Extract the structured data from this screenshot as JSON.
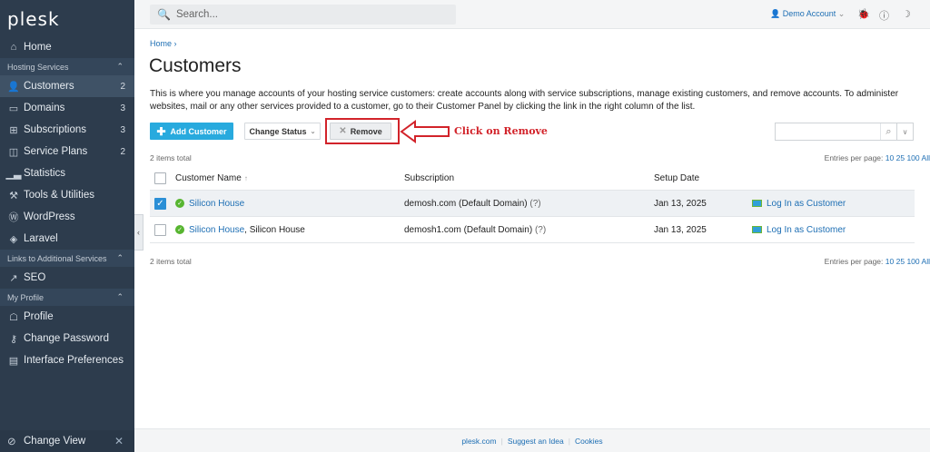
{
  "app": {
    "logo": "plesk"
  },
  "sidebar": {
    "items": [
      {
        "label": "Home",
        "icon": "home-icon"
      },
      {
        "section": "Hosting Services"
      },
      {
        "label": "Customers",
        "count": "2",
        "icon": "users-icon",
        "active": true
      },
      {
        "label": "Domains",
        "count": "3",
        "icon": "monitor-icon"
      },
      {
        "label": "Subscriptions",
        "count": "3",
        "icon": "grid-icon"
      },
      {
        "label": "Service Plans",
        "count": "2",
        "icon": "book-icon"
      },
      {
        "label": "Statistics",
        "icon": "chart-icon"
      },
      {
        "label": "Tools & Utilities",
        "icon": "tools-icon"
      },
      {
        "label": "WordPress",
        "icon": "wordpress-icon"
      },
      {
        "label": "Laravel",
        "icon": "laravel-icon"
      },
      {
        "section": "Links to Additional Services"
      },
      {
        "label": "SEO",
        "icon": "seo-icon"
      },
      {
        "section": "My Profile"
      },
      {
        "label": "Profile",
        "icon": "profile-icon"
      },
      {
        "label": "Change Password",
        "icon": "key-icon"
      },
      {
        "label": "Interface Preferences",
        "icon": "preferences-icon"
      }
    ],
    "bottom": {
      "label": "Change View"
    }
  },
  "topbar": {
    "search_placeholder": "Search...",
    "account": "Demo Account"
  },
  "main": {
    "breadcrumb": "Home",
    "title": "Customers",
    "description": "This is where you manage accounts of your hosting service customers: create accounts along with service subscriptions, manage existing customers, and remove accounts. To administer websites, mail or any other services provided to a customer, go to their Customer Panel by clicking the link in the right column of the list.",
    "buttons": {
      "add": "Add Customer",
      "status": "Change Status",
      "remove": "Remove"
    },
    "callout": "Click on Remove",
    "items_total": "2 items total",
    "entries_label": "Entries per page:",
    "entries_options": [
      "10",
      "25",
      "100",
      "All"
    ],
    "table": {
      "headers": {
        "name": "Customer Name",
        "subscription": "Subscription",
        "date": "Setup Date"
      },
      "rows": [
        {
          "name": "Silicon House",
          "name_suffix": "",
          "subscription": "demosh.com (Default Domain)",
          "q": "(?)",
          "date": "Jan 13, 2025",
          "action": "Log In as Customer",
          "checked": true
        },
        {
          "name": "Silicon House",
          "name_suffix": ", Silicon House",
          "subscription": "demosh1.com (Default Domain)",
          "q": "(?)",
          "date": "Jan 13, 2025",
          "action": "Log In as Customer",
          "checked": false
        }
      ]
    }
  },
  "footer": {
    "links": [
      "plesk.com",
      "Suggest an Idea",
      "Cookies"
    ]
  },
  "colors": {
    "sidebar": "#2d3c4d",
    "accent": "#28aade",
    "link": "#1e6fb4",
    "callout": "#d2232a"
  }
}
